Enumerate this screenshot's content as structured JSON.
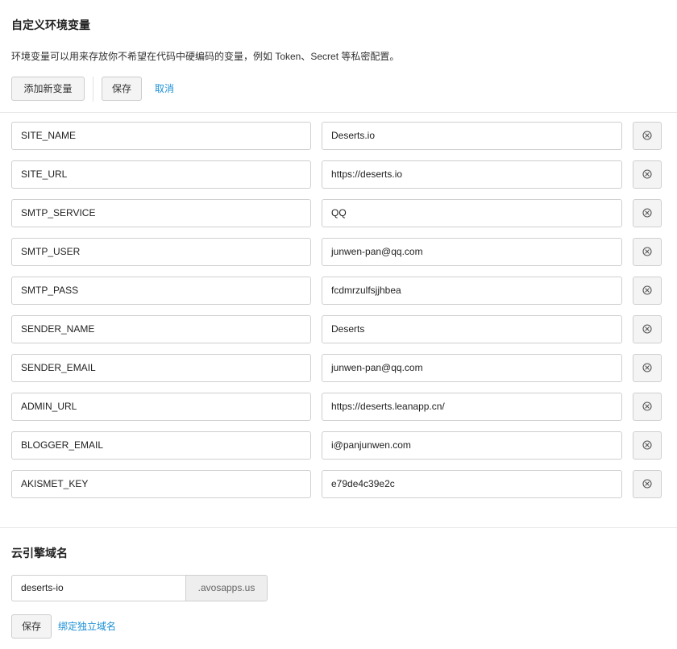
{
  "env_section": {
    "title": "自定义环境变量",
    "description": "环境变量可以用来存放你不希望在代码中硬编码的变量，例如 Token、Secret 等私密配置。",
    "add_label": "添加新变量",
    "save_label": "保存",
    "cancel_label": "取消"
  },
  "variables": [
    {
      "key": "SITE_NAME",
      "value": "Deserts.io"
    },
    {
      "key": "SITE_URL",
      "value": "https://deserts.io"
    },
    {
      "key": "SMTP_SERVICE",
      "value": "QQ"
    },
    {
      "key": "SMTP_USER",
      "value": "junwen-pan@qq.com"
    },
    {
      "key": "SMTP_PASS",
      "value": "fcdmrzulfsjjhbea"
    },
    {
      "key": "SENDER_NAME",
      "value": "Deserts"
    },
    {
      "key": "SENDER_EMAIL",
      "value": "junwen-pan@qq.com"
    },
    {
      "key": "ADMIN_URL",
      "value": "https://deserts.leanapp.cn/"
    },
    {
      "key": "BLOGGER_EMAIL",
      "value": "i@panjunwen.com"
    },
    {
      "key": "AKISMET_KEY",
      "value": "e79de4c39e2c"
    }
  ],
  "remove_icon": "close-circle-icon",
  "domain_section": {
    "title": "云引擎域名",
    "domain_value": "deserts-io",
    "suffix": ".avosapps.us",
    "save_label": "保存",
    "bind_label": "绑定独立域名"
  },
  "colors": {
    "link": "#1a8fd6",
    "button_bg": "#f4f4f4",
    "border": "#cfcfcf"
  }
}
